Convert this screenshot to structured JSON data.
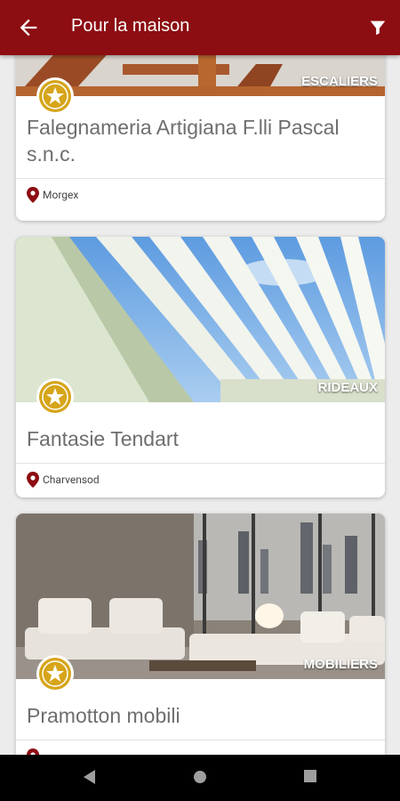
{
  "appbar": {
    "title": "Pour la maison"
  },
  "cards": [
    {
      "category": "ESCALIERS",
      "name": "Falegnameria Artigiana F.lli Pascal s.n.c.",
      "location": "Morgex"
    },
    {
      "category": "RIDEAUX",
      "name": "Fantasie Tendart",
      "location": "Charvensod"
    },
    {
      "category": "MOBILIERS",
      "name": "Pramotton mobili",
      "location": ""
    }
  ],
  "colors": {
    "accent": "#8c0d12",
    "gold": "#d6a51a"
  }
}
